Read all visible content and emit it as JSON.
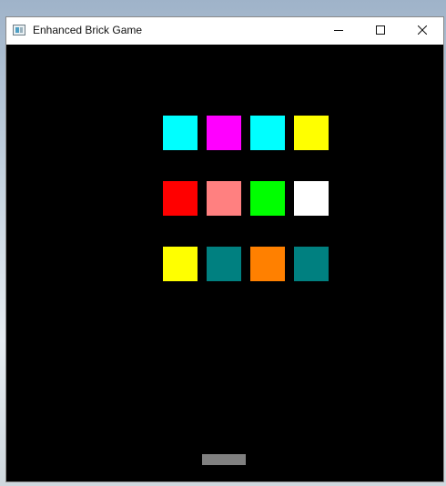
{
  "window": {
    "title": "Enhanced Brick Game",
    "icon": "app-window-icon",
    "controls": [
      {
        "name": "minimize-icon"
      },
      {
        "name": "maximize-icon"
      },
      {
        "name": "close-icon"
      }
    ]
  },
  "game": {
    "background": "#000000",
    "bricks": [
      [
        "#00ffff",
        "#ff00ff",
        "#00ffff",
        "#ffff00"
      ],
      [
        "#ff0000",
        "#ff8080",
        "#00ff00",
        "#ffffff"
      ],
      [
        "#ffff00",
        "#008080",
        "#ff8000",
        "#008080"
      ]
    ],
    "paddle_color": "#808080"
  }
}
